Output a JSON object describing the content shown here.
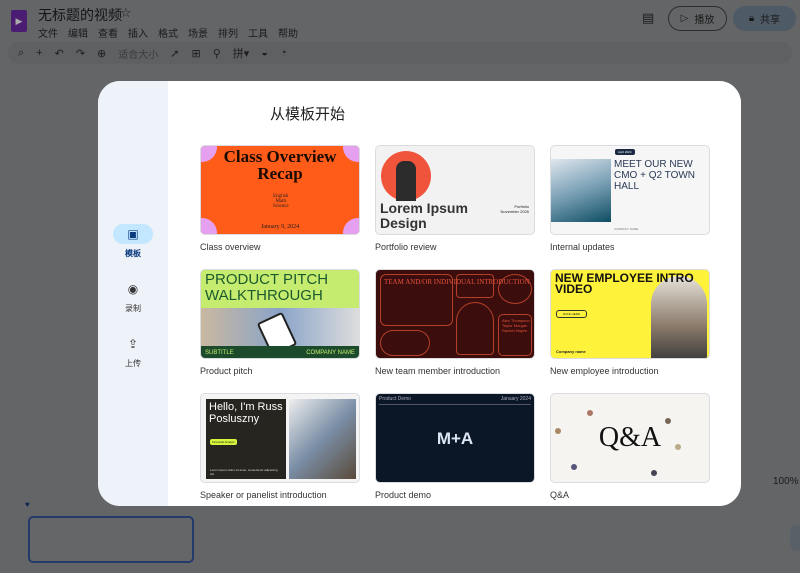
{
  "app": {
    "title": "无标题的视频",
    "menu": [
      "文件",
      "编辑",
      "查看",
      "插入",
      "格式",
      "场景",
      "排列",
      "工具",
      "帮助"
    ],
    "toolbar": {
      "fit": "适合大小"
    },
    "play_label": "播放",
    "share_label": "共享",
    "zoom": "100%"
  },
  "dialog": {
    "title": "从模板开始",
    "nav": [
      {
        "label": "模板",
        "icon": "template-icon",
        "active": true
      },
      {
        "label": "录制",
        "icon": "record-icon"
      },
      {
        "label": "上传",
        "icon": "upload-icon"
      }
    ],
    "templates": [
      {
        "label": "Class overview",
        "thumb": {
          "title": "Class Overview Recap",
          "items": "English\nMath\nScience",
          "date": "January 9, 2024"
        }
      },
      {
        "label": "Portfolio review",
        "thumb": {
          "title": "Lorem Ipsum Design",
          "meta": "Portfolio\nNovember 2026"
        }
      },
      {
        "label": "Internal updates",
        "thumb": {
          "title": "MEET OUR NEW CMO + Q2 TOWN HALL",
          "tag": "April 2024",
          "footer": "COMPANY NAME"
        }
      },
      {
        "label": "Product pitch",
        "thumb": {
          "title": "PRODUCT PITCH WALKTHROUGH",
          "subtitle": "SUBTITLE",
          "company": "COMPANY NAME"
        }
      },
      {
        "label": "New team member introduction",
        "thumb": {
          "title": "TEAM AND/OR INDIVIDUAL INTRODUCTION",
          "names": "Alex Thompson\nTaylor Morgan\nRachel Hayes"
        }
      },
      {
        "label": "New employee introduction",
        "thumb": {
          "title": "NEW EMPLOYEE INTRO VIDEO",
          "date": "DATE HERE",
          "company": "Company name"
        }
      },
      {
        "label": "Speaker or panelist introduction",
        "thumb": {
          "title": "Hello, I'm Russ Posluszny",
          "tag": "Financial Analyst",
          "body": "Lorem ipsum dolor sit amet, consectetur adipiscing elit."
        }
      },
      {
        "label": "Product demo",
        "thumb": {
          "left": "Product Demo",
          "right": "January 2024",
          "title": "M+A"
        }
      },
      {
        "label": "Q&A",
        "thumb": {
          "title": "Q&A"
        }
      }
    ]
  },
  "colors": {
    "accent": "#0b57d0",
    "share_bg": "#c2e7ff",
    "class_orange": "#ff5c1a",
    "pitch_green": "#c5ec6e",
    "team_maroon": "#3b0d0d",
    "employee_yellow": "#fff23a",
    "demo_navy": "#0b1727"
  }
}
